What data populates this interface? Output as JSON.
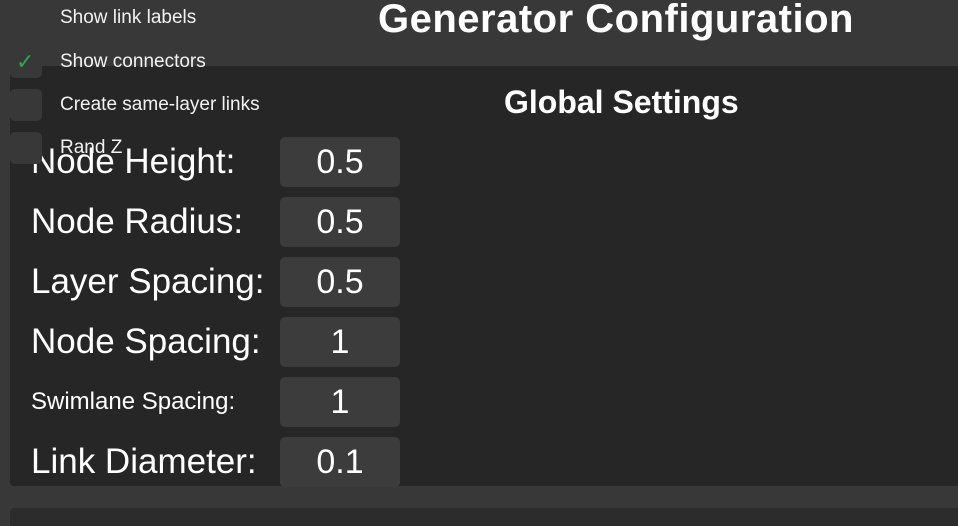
{
  "window": {
    "title": "Generator Configuration"
  },
  "checkboxes": [
    {
      "label": "Show link labels",
      "checked": false
    },
    {
      "label": "Show connectors",
      "checked": true
    },
    {
      "label": "Create same-layer links",
      "checked": false
    },
    {
      "label": "Rand Z",
      "checked": false
    }
  ],
  "global_settings": {
    "heading": "Global Settings",
    "fields": [
      {
        "label": "Node Height:",
        "value": "0.5"
      },
      {
        "label": "Node Radius:",
        "value": "0.5"
      },
      {
        "label": "Layer Spacing:",
        "value": "0.5"
      },
      {
        "label": "Node Spacing:",
        "value": "1"
      },
      {
        "label": "Swimlane Spacing:",
        "value": "1"
      },
      {
        "label": "Link Diameter:",
        "value": "0.1"
      }
    ]
  },
  "colors": {
    "background": "#383838",
    "panel": "#262626",
    "field": "#3c3c3c",
    "check": "#2ea54a"
  },
  "icons": {
    "checkmark": "checkmark-icon"
  }
}
